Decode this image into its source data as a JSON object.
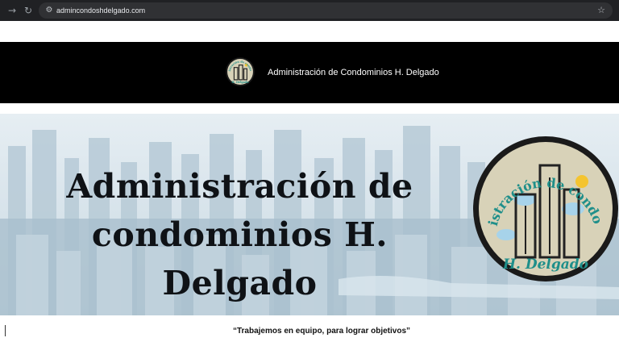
{
  "browser": {
    "url": "admincondoshdelgado.com",
    "forward_icon": "arrow-right-icon",
    "reload_icon": "reload-icon",
    "site_info_icon": "tune-icon",
    "bookmark_icon": "star-icon"
  },
  "header": {
    "title": "Administración de Condominios H. Delgado",
    "logo_text_top": "Administración de condominios",
    "logo_text_bottom": "H. Delgado"
  },
  "hero": {
    "title_line1": "Administración de",
    "title_line2": "condominios H. Delgado",
    "badge_text_top": "Administración de condominios",
    "badge_text_bottom": "H. Delgado"
  },
  "motto": "“Trabajemos en equipo, para lograr objetivos”",
  "colors": {
    "header_bg": "#000000",
    "badge_ring": "#1a1a1a",
    "badge_fill": "#d8d2b8",
    "badge_text": "#1f8f8a",
    "sun": "#f4c430"
  }
}
